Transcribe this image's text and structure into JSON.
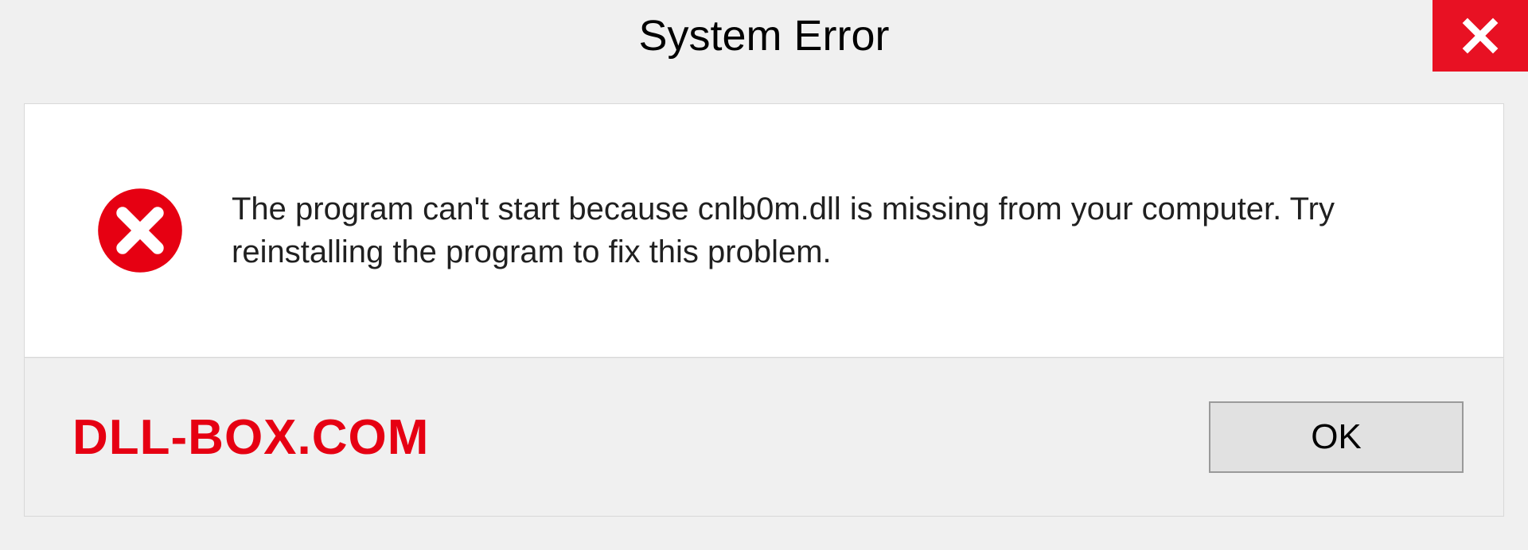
{
  "dialog": {
    "title": "System Error",
    "message": "The program can't start because cnlb0m.dll is missing from your computer. Try reinstalling the program to fix this problem.",
    "ok_label": "OK"
  },
  "watermark": "DLL-BOX.COM"
}
